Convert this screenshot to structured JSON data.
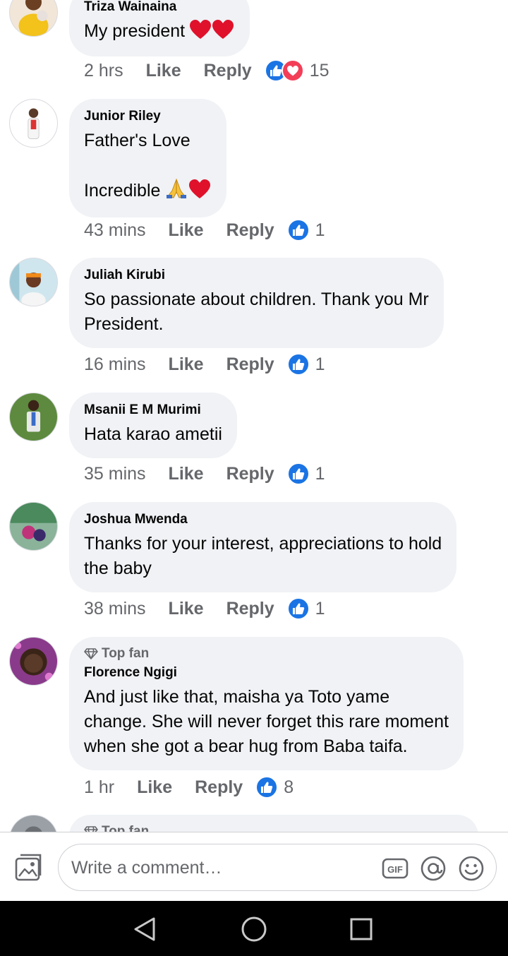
{
  "comments": [
    {
      "author": "Triza Wainaina",
      "text": "My president",
      "emoji": [
        "heart",
        "heart"
      ],
      "time": "2 hrs",
      "like_label": "Like",
      "reply_label": "Reply",
      "reactions": [
        "like",
        "love"
      ],
      "reaction_count": "15"
    },
    {
      "author": "Junior Riley",
      "text": "Father's Love\n\nIncredible",
      "emoji": [
        "pray",
        "heart"
      ],
      "time": "43 mins",
      "like_label": "Like",
      "reply_label": "Reply",
      "reactions": [
        "like"
      ],
      "reaction_count": "1"
    },
    {
      "author": "Juliah Kirubi",
      "text": "So passionate about children. Thank you Mr\nPresident.",
      "time": "16 mins",
      "like_label": "Like",
      "reply_label": "Reply",
      "reactions": [
        "like"
      ],
      "reaction_count": "1"
    },
    {
      "author": "Msanii E M Murimi",
      "text": "Hata karao ametii",
      "time": "35 mins",
      "like_label": "Like",
      "reply_label": "Reply",
      "reactions": [
        "like"
      ],
      "reaction_count": "1"
    },
    {
      "author": "Joshua Mwenda",
      "text": "Thanks for your interest, appreciations to hold\nthe baby",
      "time": "38 mins",
      "like_label": "Like",
      "reply_label": "Reply",
      "reactions": [
        "like"
      ],
      "reaction_count": "1"
    },
    {
      "badge": "Top fan",
      "author": "Florence Ngigi",
      "text": "And just like that, maisha ya Toto yame\nchange. She will never forget this rare moment\nwhen she got a bear hug from Baba taifa.",
      "time": "1 hr",
      "like_label": "Like",
      "reply_label": "Reply",
      "reactions": [
        "like"
      ],
      "reaction_count": "8"
    },
    {
      "badge": "Top fan"
    }
  ],
  "composer": {
    "placeholder": "Write a comment…",
    "icons": [
      "photo-icon",
      "gif-icon",
      "mention-icon",
      "emoji-icon"
    ]
  },
  "navbar": {
    "icons": [
      "back-icon",
      "home-icon",
      "recents-icon"
    ]
  },
  "colors": {
    "bubble": "#f0f2f5",
    "like_blue": "#1b74e4",
    "love_red": "#f33e58",
    "secondary_text": "#65676b"
  }
}
